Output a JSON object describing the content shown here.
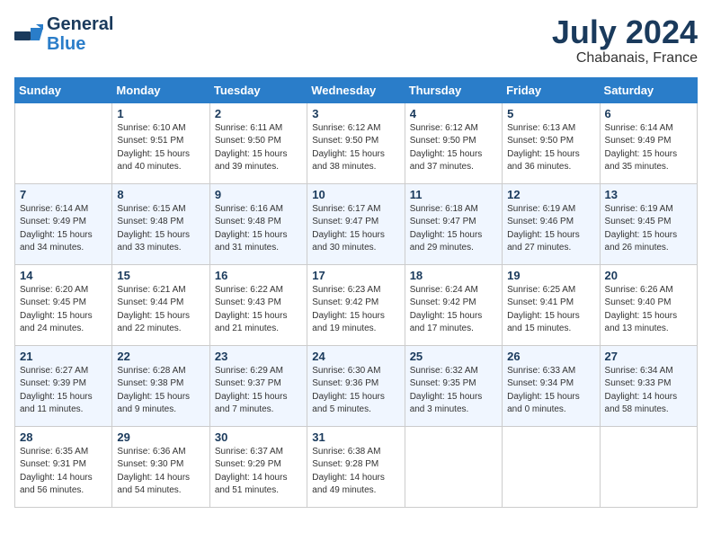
{
  "logo": {
    "line1": "General",
    "line2": "Blue"
  },
  "title": {
    "month_year": "July 2024",
    "location": "Chabanais, France"
  },
  "days_of_week": [
    "Sunday",
    "Monday",
    "Tuesday",
    "Wednesday",
    "Thursday",
    "Friday",
    "Saturday"
  ],
  "weeks": [
    {
      "days": [
        {
          "num": "",
          "empty": true
        },
        {
          "num": "1",
          "sunrise": "Sunrise: 6:10 AM",
          "sunset": "Sunset: 9:51 PM",
          "daylight": "Daylight: 15 hours and 40 minutes."
        },
        {
          "num": "2",
          "sunrise": "Sunrise: 6:11 AM",
          "sunset": "Sunset: 9:50 PM",
          "daylight": "Daylight: 15 hours and 39 minutes."
        },
        {
          "num": "3",
          "sunrise": "Sunrise: 6:12 AM",
          "sunset": "Sunset: 9:50 PM",
          "daylight": "Daylight: 15 hours and 38 minutes."
        },
        {
          "num": "4",
          "sunrise": "Sunrise: 6:12 AM",
          "sunset": "Sunset: 9:50 PM",
          "daylight": "Daylight: 15 hours and 37 minutes."
        },
        {
          "num": "5",
          "sunrise": "Sunrise: 6:13 AM",
          "sunset": "Sunset: 9:50 PM",
          "daylight": "Daylight: 15 hours and 36 minutes."
        },
        {
          "num": "6",
          "sunrise": "Sunrise: 6:14 AM",
          "sunset": "Sunset: 9:49 PM",
          "daylight": "Daylight: 15 hours and 35 minutes."
        }
      ]
    },
    {
      "days": [
        {
          "num": "7",
          "sunrise": "Sunrise: 6:14 AM",
          "sunset": "Sunset: 9:49 PM",
          "daylight": "Daylight: 15 hours and 34 minutes."
        },
        {
          "num": "8",
          "sunrise": "Sunrise: 6:15 AM",
          "sunset": "Sunset: 9:48 PM",
          "daylight": "Daylight: 15 hours and 33 minutes."
        },
        {
          "num": "9",
          "sunrise": "Sunrise: 6:16 AM",
          "sunset": "Sunset: 9:48 PM",
          "daylight": "Daylight: 15 hours and 31 minutes."
        },
        {
          "num": "10",
          "sunrise": "Sunrise: 6:17 AM",
          "sunset": "Sunset: 9:47 PM",
          "daylight": "Daylight: 15 hours and 30 minutes."
        },
        {
          "num": "11",
          "sunrise": "Sunrise: 6:18 AM",
          "sunset": "Sunset: 9:47 PM",
          "daylight": "Daylight: 15 hours and 29 minutes."
        },
        {
          "num": "12",
          "sunrise": "Sunrise: 6:19 AM",
          "sunset": "Sunset: 9:46 PM",
          "daylight": "Daylight: 15 hours and 27 minutes."
        },
        {
          "num": "13",
          "sunrise": "Sunrise: 6:19 AM",
          "sunset": "Sunset: 9:45 PM",
          "daylight": "Daylight: 15 hours and 26 minutes."
        }
      ]
    },
    {
      "days": [
        {
          "num": "14",
          "sunrise": "Sunrise: 6:20 AM",
          "sunset": "Sunset: 9:45 PM",
          "daylight": "Daylight: 15 hours and 24 minutes."
        },
        {
          "num": "15",
          "sunrise": "Sunrise: 6:21 AM",
          "sunset": "Sunset: 9:44 PM",
          "daylight": "Daylight: 15 hours and 22 minutes."
        },
        {
          "num": "16",
          "sunrise": "Sunrise: 6:22 AM",
          "sunset": "Sunset: 9:43 PM",
          "daylight": "Daylight: 15 hours and 21 minutes."
        },
        {
          "num": "17",
          "sunrise": "Sunrise: 6:23 AM",
          "sunset": "Sunset: 9:42 PM",
          "daylight": "Daylight: 15 hours and 19 minutes."
        },
        {
          "num": "18",
          "sunrise": "Sunrise: 6:24 AM",
          "sunset": "Sunset: 9:42 PM",
          "daylight": "Daylight: 15 hours and 17 minutes."
        },
        {
          "num": "19",
          "sunrise": "Sunrise: 6:25 AM",
          "sunset": "Sunset: 9:41 PM",
          "daylight": "Daylight: 15 hours and 15 minutes."
        },
        {
          "num": "20",
          "sunrise": "Sunrise: 6:26 AM",
          "sunset": "Sunset: 9:40 PM",
          "daylight": "Daylight: 15 hours and 13 minutes."
        }
      ]
    },
    {
      "days": [
        {
          "num": "21",
          "sunrise": "Sunrise: 6:27 AM",
          "sunset": "Sunset: 9:39 PM",
          "daylight": "Daylight: 15 hours and 11 minutes."
        },
        {
          "num": "22",
          "sunrise": "Sunrise: 6:28 AM",
          "sunset": "Sunset: 9:38 PM",
          "daylight": "Daylight: 15 hours and 9 minutes."
        },
        {
          "num": "23",
          "sunrise": "Sunrise: 6:29 AM",
          "sunset": "Sunset: 9:37 PM",
          "daylight": "Daylight: 15 hours and 7 minutes."
        },
        {
          "num": "24",
          "sunrise": "Sunrise: 6:30 AM",
          "sunset": "Sunset: 9:36 PM",
          "daylight": "Daylight: 15 hours and 5 minutes."
        },
        {
          "num": "25",
          "sunrise": "Sunrise: 6:32 AM",
          "sunset": "Sunset: 9:35 PM",
          "daylight": "Daylight: 15 hours and 3 minutes."
        },
        {
          "num": "26",
          "sunrise": "Sunrise: 6:33 AM",
          "sunset": "Sunset: 9:34 PM",
          "daylight": "Daylight: 15 hours and 0 minutes."
        },
        {
          "num": "27",
          "sunrise": "Sunrise: 6:34 AM",
          "sunset": "Sunset: 9:33 PM",
          "daylight": "Daylight: 14 hours and 58 minutes."
        }
      ]
    },
    {
      "days": [
        {
          "num": "28",
          "sunrise": "Sunrise: 6:35 AM",
          "sunset": "Sunset: 9:31 PM",
          "daylight": "Daylight: 14 hours and 56 minutes."
        },
        {
          "num": "29",
          "sunrise": "Sunrise: 6:36 AM",
          "sunset": "Sunset: 9:30 PM",
          "daylight": "Daylight: 14 hours and 54 minutes."
        },
        {
          "num": "30",
          "sunrise": "Sunrise: 6:37 AM",
          "sunset": "Sunset: 9:29 PM",
          "daylight": "Daylight: 14 hours and 51 minutes."
        },
        {
          "num": "31",
          "sunrise": "Sunrise: 6:38 AM",
          "sunset": "Sunset: 9:28 PM",
          "daylight": "Daylight: 14 hours and 49 minutes."
        },
        {
          "num": "",
          "empty": true
        },
        {
          "num": "",
          "empty": true
        },
        {
          "num": "",
          "empty": true
        }
      ]
    }
  ]
}
